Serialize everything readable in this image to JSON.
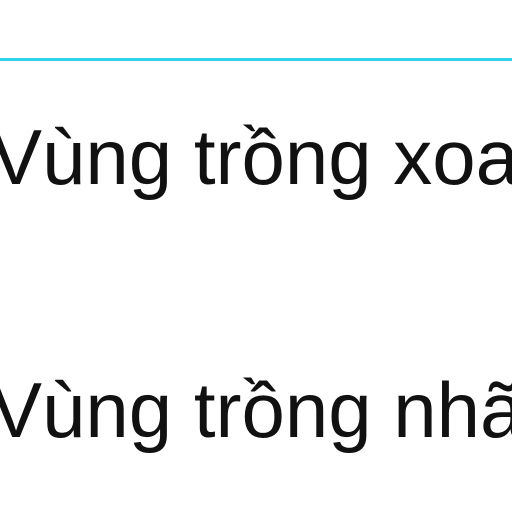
{
  "divider": {
    "color": "#2fd3ea"
  },
  "list": {
    "items": [
      {
        "label": "Vùng trồng xoa"
      },
      {
        "label": "Vùng trồng nhã"
      }
    ]
  }
}
